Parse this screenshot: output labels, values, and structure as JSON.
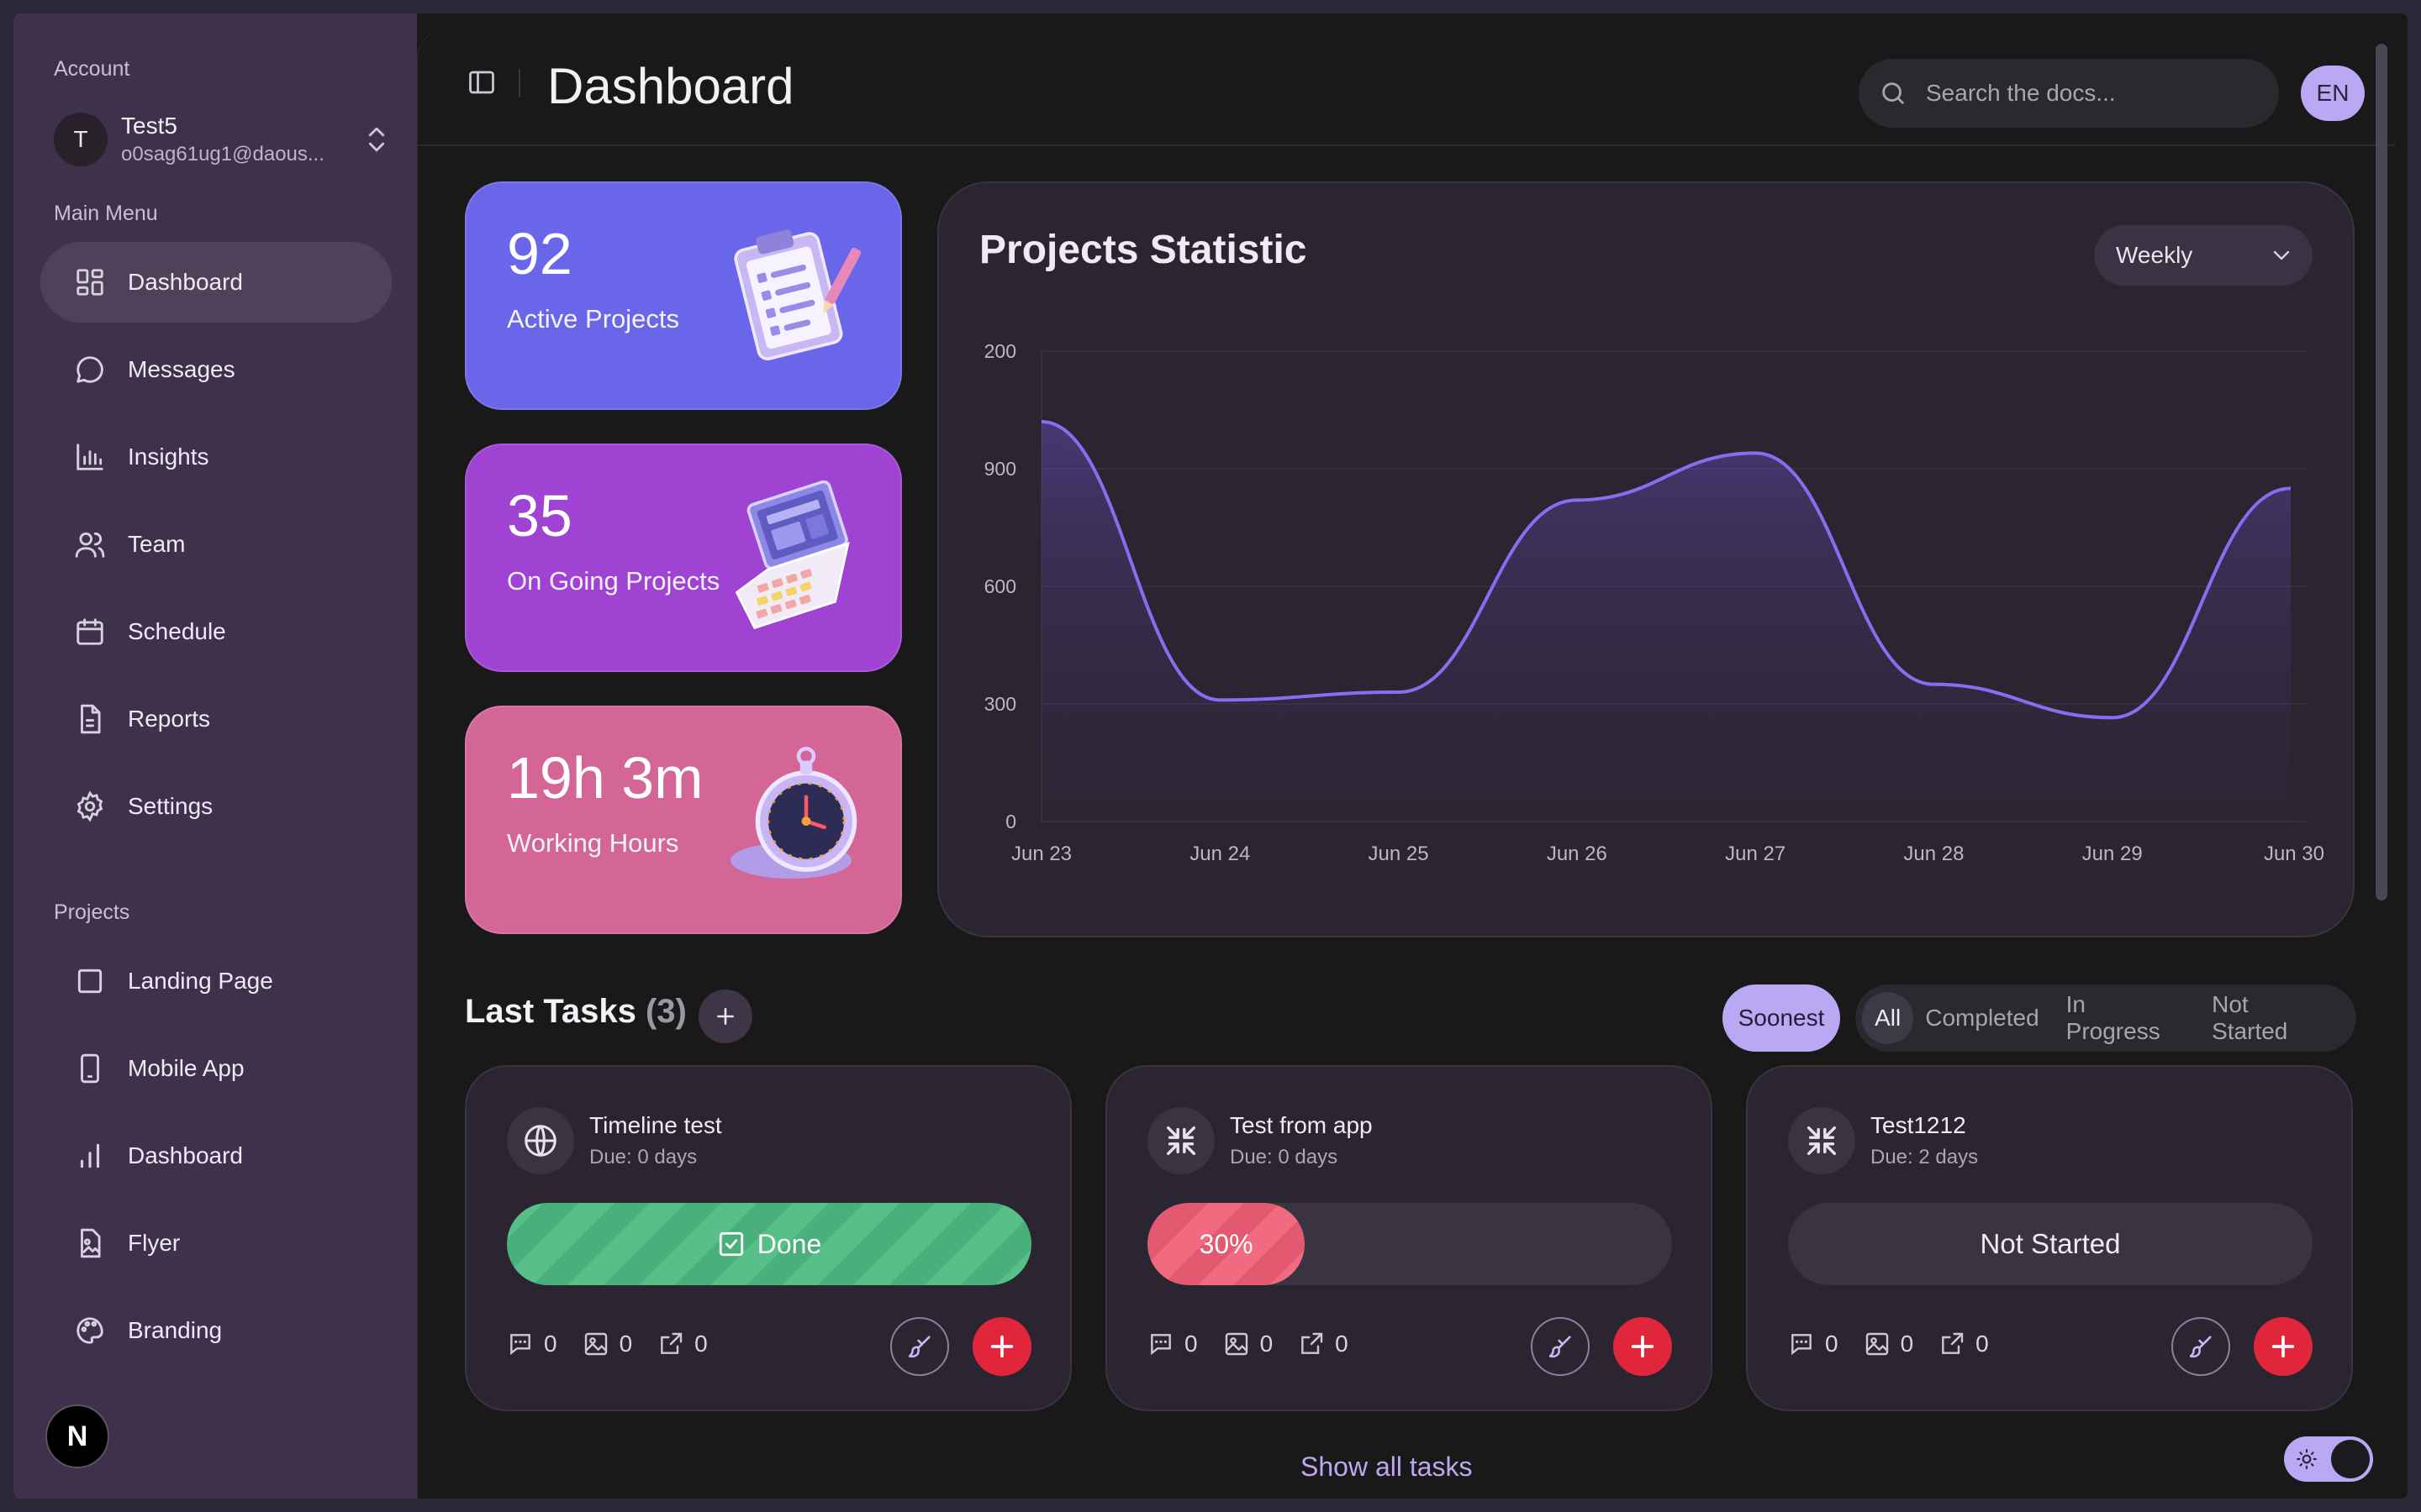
{
  "sidebar": {
    "account_label": "Account",
    "account": {
      "initial": "T",
      "name": "Test5",
      "email": "o0sag61ug1@daous..."
    },
    "main_menu_label": "Main Menu",
    "main_menu": [
      {
        "label": "Dashboard",
        "icon": "dashboard-icon",
        "active": true
      },
      {
        "label": "Messages",
        "icon": "messages-icon"
      },
      {
        "label": "Insights",
        "icon": "insights-icon"
      },
      {
        "label": "Team",
        "icon": "team-icon"
      },
      {
        "label": "Schedule",
        "icon": "calendar-icon"
      },
      {
        "label": "Reports",
        "icon": "reports-icon"
      },
      {
        "label": "Settings",
        "icon": "gear-icon"
      }
    ],
    "projects_label": "Projects",
    "projects": [
      {
        "label": "Landing Page",
        "icon": "square-icon"
      },
      {
        "label": "Mobile App",
        "icon": "mobile-icon"
      },
      {
        "label": "Dashboard",
        "icon": "bar-chart-icon"
      },
      {
        "label": "Flyer",
        "icon": "image-file-icon"
      },
      {
        "label": "Branding",
        "icon": "palette-icon"
      }
    ],
    "logo_letter": "N"
  },
  "header": {
    "title": "Dashboard",
    "search_placeholder": "Search the docs...",
    "language": "EN"
  },
  "stats": [
    {
      "value": "92",
      "label": "Active Projects",
      "color": "#6a66ea",
      "icon": "clipboard-icon"
    },
    {
      "value": "35",
      "label": "On Going Projects",
      "color": "#a042d2",
      "icon": "laptop-icon"
    },
    {
      "value": "19h 3m",
      "label": "Working Hours",
      "color": "#d46697",
      "icon": "stopwatch-icon"
    }
  ],
  "chart": {
    "title": "Projects Statistic",
    "period": "Weekly"
  },
  "chart_data": {
    "type": "area",
    "x": [
      "Jun 23",
      "Jun 24",
      "Jun 25",
      "Jun 26",
      "Jun 27",
      "Jun 28",
      "Jun 29",
      "Jun 30"
    ],
    "y_ticks": [
      "200",
      "900",
      "600",
      "300",
      "0"
    ],
    "series": [
      {
        "values": [
          1020,
          310,
          330,
          820,
          940,
          350,
          265,
          850
        ]
      }
    ],
    "ylim": [
      0,
      1200
    ],
    "grid": true,
    "color": "#8b6cf0"
  },
  "tasks": {
    "title": "Last Tasks",
    "count": "(3)",
    "sort_label": "Soonest",
    "filters": [
      "All",
      "Completed",
      "In Progress",
      "Not Started"
    ],
    "items": [
      {
        "name": "Timeline test",
        "due": "Due: 0 days",
        "icon": "globe-icon",
        "status": "Done",
        "progress": 1.0,
        "comments": "0",
        "images": "0",
        "links": "0"
      },
      {
        "name": "Test from app",
        "due": "Due: 0 days",
        "icon": "collapse-icon",
        "status": "30%",
        "progress": 0.3,
        "comments": "0",
        "images": "0",
        "links": "0"
      },
      {
        "name": "Test1212",
        "due": "Due: 2 days",
        "icon": "collapse-icon",
        "status": "Not Started",
        "progress": 0,
        "comments": "0",
        "images": "0",
        "links": "0"
      }
    ],
    "show_all": "Show all tasks"
  }
}
